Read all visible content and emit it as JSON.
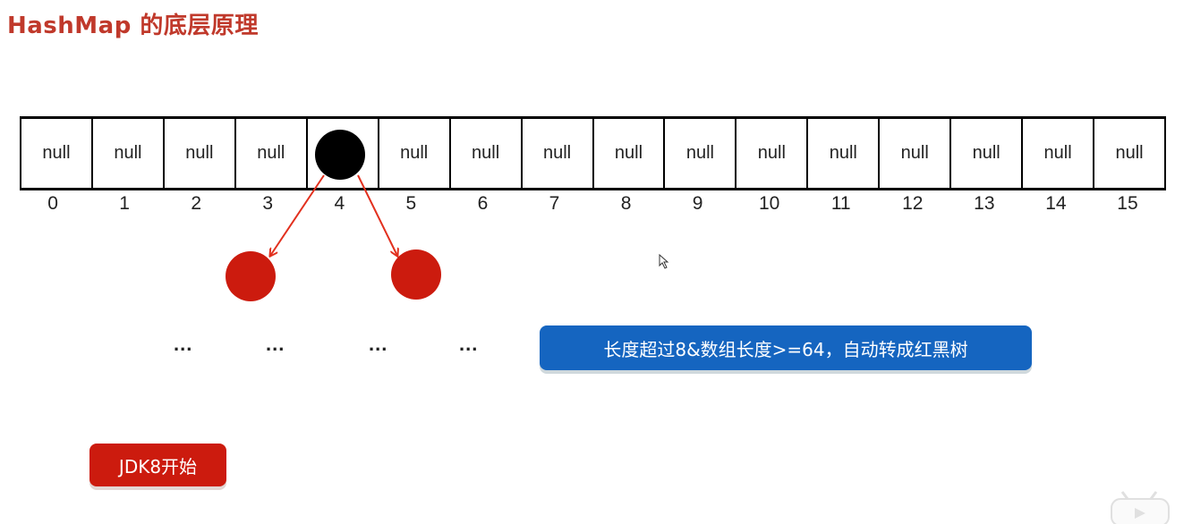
{
  "title": "HashMap 的底层原理",
  "array": {
    "cells": [
      "null",
      "null",
      "null",
      "null",
      "",
      "null",
      "null",
      "null",
      "null",
      "null",
      "null",
      "null",
      "null",
      "null",
      "null",
      "null"
    ],
    "indices": [
      "0",
      "1",
      "2",
      "3",
      "4",
      "5",
      "6",
      "7",
      "8",
      "9",
      "10",
      "11",
      "12",
      "13",
      "14",
      "15"
    ],
    "occupied_index": 4
  },
  "tree": {
    "root_color": "#000000",
    "child_color": "#cc1b0e",
    "edge_color": "#e2301e",
    "ellipsis": [
      "...",
      "...",
      "...",
      "..."
    ]
  },
  "callout": {
    "text": "长度超过8&数组长度>=64，自动转成红黑树",
    "color": "#1565c0"
  },
  "tag": {
    "text": "JDK8开始",
    "color": "#cc1b0e"
  }
}
